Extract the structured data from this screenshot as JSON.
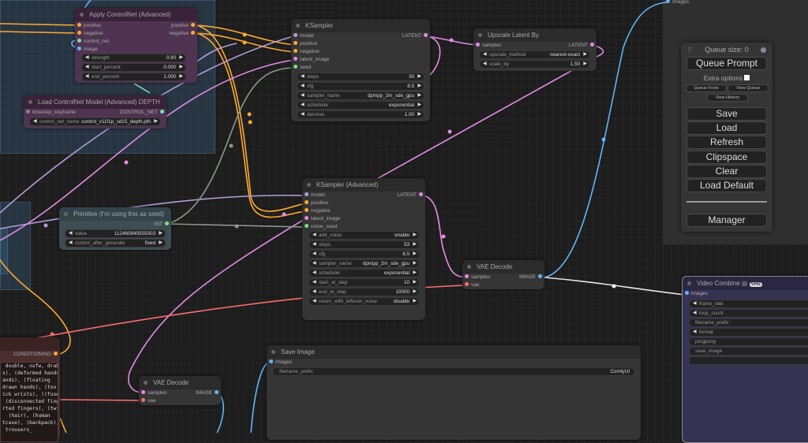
{
  "colors": {
    "canvas_bg": "#1d1d1d",
    "model_link": "#b39ddb",
    "conditioning_link": "#ffa931",
    "latent_link": "#e58be8",
    "int_link": "#8a9a8a",
    "image_link": "#64b5f6",
    "vae_link": "#ff6e6e",
    "control_net_link": "#7fe0b0"
  },
  "nodes": {
    "apply_controlnet": {
      "title": "Apply ControlNet (Advanced)",
      "inputs": [
        "positive",
        "negative",
        "control_net",
        "image"
      ],
      "outputs": [
        "positive",
        "negative"
      ],
      "widgets": [
        {
          "label": "strength",
          "value": "0.90"
        },
        {
          "label": "start_percent",
          "value": "0.000"
        },
        {
          "label": "end_percent",
          "value": "1.000"
        }
      ]
    },
    "load_controlnet": {
      "title": "Load ControlNet Model (Advanced) DEPTH",
      "inputs": [
        "timestep_keyframe"
      ],
      "outputs": [
        "CONTROL_NET"
      ],
      "widgets": [
        {
          "label": "control_net_name",
          "value": "control_v11f1p_sd15_depth.pth"
        }
      ]
    },
    "ksampler": {
      "title": "KSampler",
      "inputs": [
        "model",
        "positive",
        "negative",
        "latent_image",
        "seed"
      ],
      "outputs": [
        "LATENT"
      ],
      "widgets": [
        {
          "label": "steps",
          "value": "30"
        },
        {
          "label": "cfg",
          "value": "8.5"
        },
        {
          "label": "sampler_name",
          "value": "dpmpp_2m_sde_gpu"
        },
        {
          "label": "scheduler",
          "value": "exponential"
        },
        {
          "label": "denoise",
          "value": "1.00"
        }
      ]
    },
    "upscale_latent": {
      "title": "Upscale Latent By",
      "inputs": [
        "samples"
      ],
      "outputs": [
        "LATENT"
      ],
      "widgets": [
        {
          "label": "upscale_method",
          "value": "nearest-exact"
        },
        {
          "label": "scale_by",
          "value": "1.50"
        }
      ]
    },
    "primitive": {
      "title": "Primitive (I'm using this as seed)",
      "outputs": [
        "INT"
      ],
      "widgets": [
        {
          "label": "value",
          "value": "112460840555003"
        },
        {
          "label": "control_after_generate",
          "value": "fixed"
        }
      ]
    },
    "ksampler_advanced": {
      "title": "KSampler (Advanced)",
      "inputs": [
        "model",
        "positive",
        "negative",
        "latent_image",
        "noise_seed"
      ],
      "outputs": [
        "LATENT"
      ],
      "widgets": [
        {
          "label": "add_noise",
          "value": "enable"
        },
        {
          "label": "steps",
          "value": "53"
        },
        {
          "label": "cfg",
          "value": "8.5"
        },
        {
          "label": "sampler_name",
          "value": "dpmpp_2m_sde_gpu"
        },
        {
          "label": "scheduler",
          "value": "exponential"
        },
        {
          "label": "start_at_step",
          "value": "10"
        },
        {
          "label": "end_at_step",
          "value": "10000"
        },
        {
          "label": "return_with_leftover_noise",
          "value": "disable"
        }
      ]
    },
    "vae_decode_1": {
      "title": "VAE Decode",
      "inputs": [
        "samples",
        "vae"
      ],
      "outputs": [
        "IMAGE"
      ]
    },
    "vae_decode_2": {
      "title": "VAE Decode",
      "inputs": [
        "samples",
        "vae"
      ],
      "outputs": [
        "IMAGE"
      ]
    },
    "save_image": {
      "title": "Save Image",
      "inputs": [
        "images"
      ],
      "widgets": [
        {
          "label": "filename_prefix",
          "value": "ComfyUI"
        }
      ]
    },
    "video_combine": {
      "title": "Video Combine",
      "badge": "VHS",
      "inputs": [
        "images"
      ],
      "widgets": [
        "frame_rate",
        "loop_count",
        "filename_prefix",
        "format",
        "pingpong",
        "save_image"
      ]
    },
    "negative_prompt": {
      "outputs": [
        "CONDITIONING"
      ],
      "text_lines": [
        " double, nsfw, drab,",
        "s), (deformed hands),",
        "ands), (floating",
        "drawn hands), (too many",
        "ick wrists), ((fused",
        " (disconnected fingers),",
        "rted fingers), (twisted",
        "  (hair), (human",
        "tcase), (backpack),",
        " trousers_"
      ]
    },
    "offscreen_node": {
      "inputs": [
        "images"
      ]
    }
  },
  "menu": {
    "queue_size": "Queue size: 0",
    "queue_prompt": "Queue Prompt",
    "extra_options": "Extra options",
    "queue_front": "Queue Front",
    "view_queue": "View Queue",
    "view_history": "View History",
    "save": "Save",
    "load": "Load",
    "refresh": "Refresh",
    "clipspace": "Clipspace",
    "clear": "Clear",
    "load_default": "Load Default",
    "manager": "Manager"
  }
}
